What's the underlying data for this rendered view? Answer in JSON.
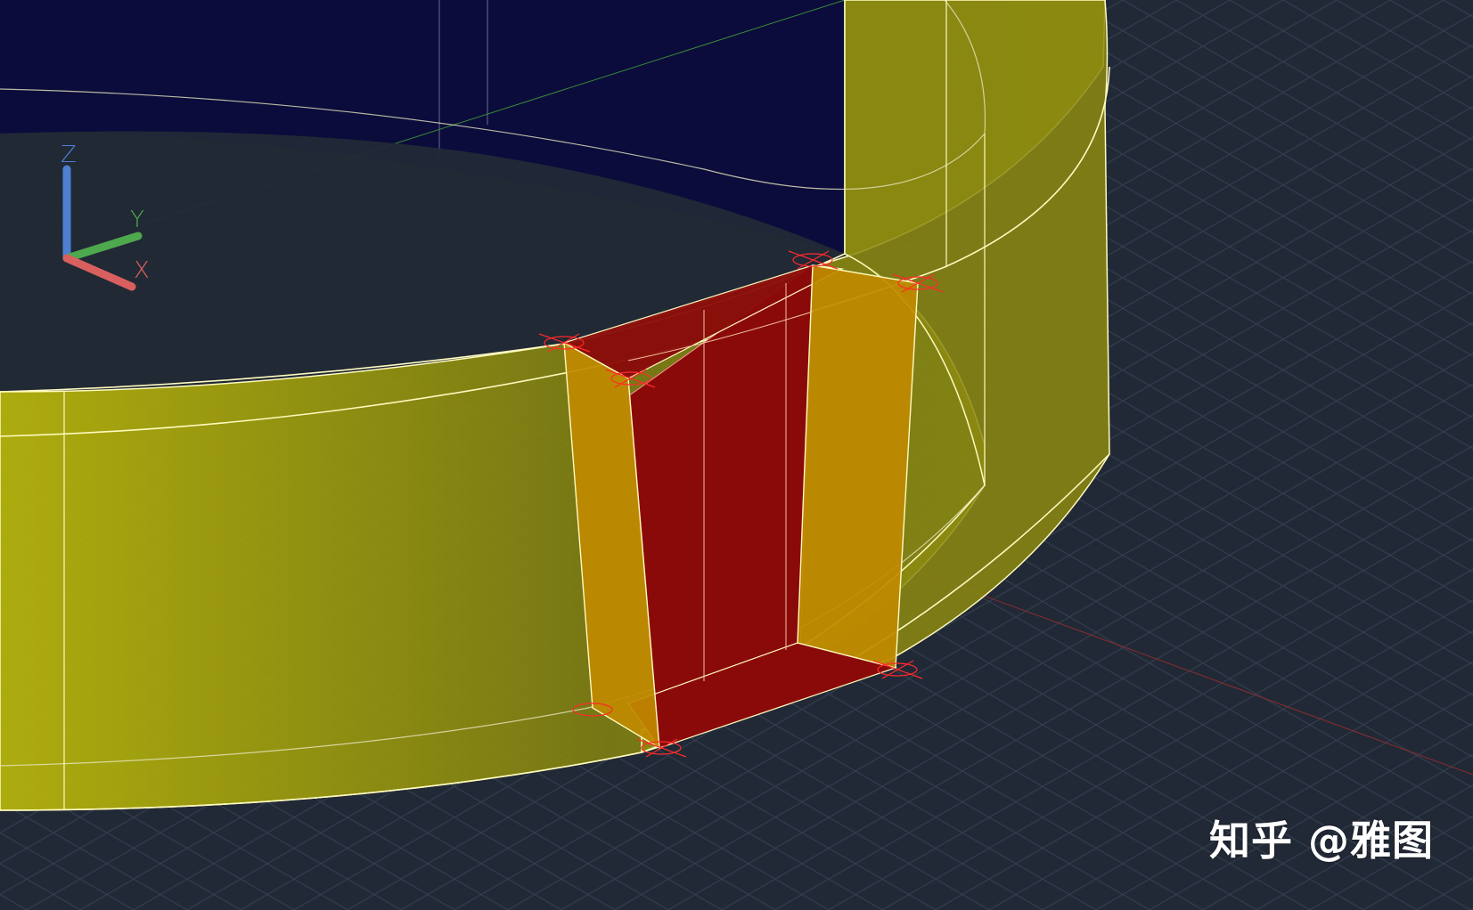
{
  "viewport": {
    "background": "#222936",
    "grid_color": "#34404f",
    "sky_color": "#0b0c3b"
  },
  "model": {
    "ring_fill": "#b8b800",
    "ring_edge": "#fffbbf",
    "cutout_fill": "#8a0a0a",
    "cutout_side_fill": "#c08a00",
    "grip_color": "#ff2a2a"
  },
  "ucs": {
    "x_label": "X",
    "y_label": "Y",
    "z_label": "Z",
    "x_color": "#d9605f",
    "y_color": "#4ea84e",
    "z_color": "#4e7fd1"
  },
  "watermark": {
    "platform": "知乎",
    "author": "@雅图"
  }
}
